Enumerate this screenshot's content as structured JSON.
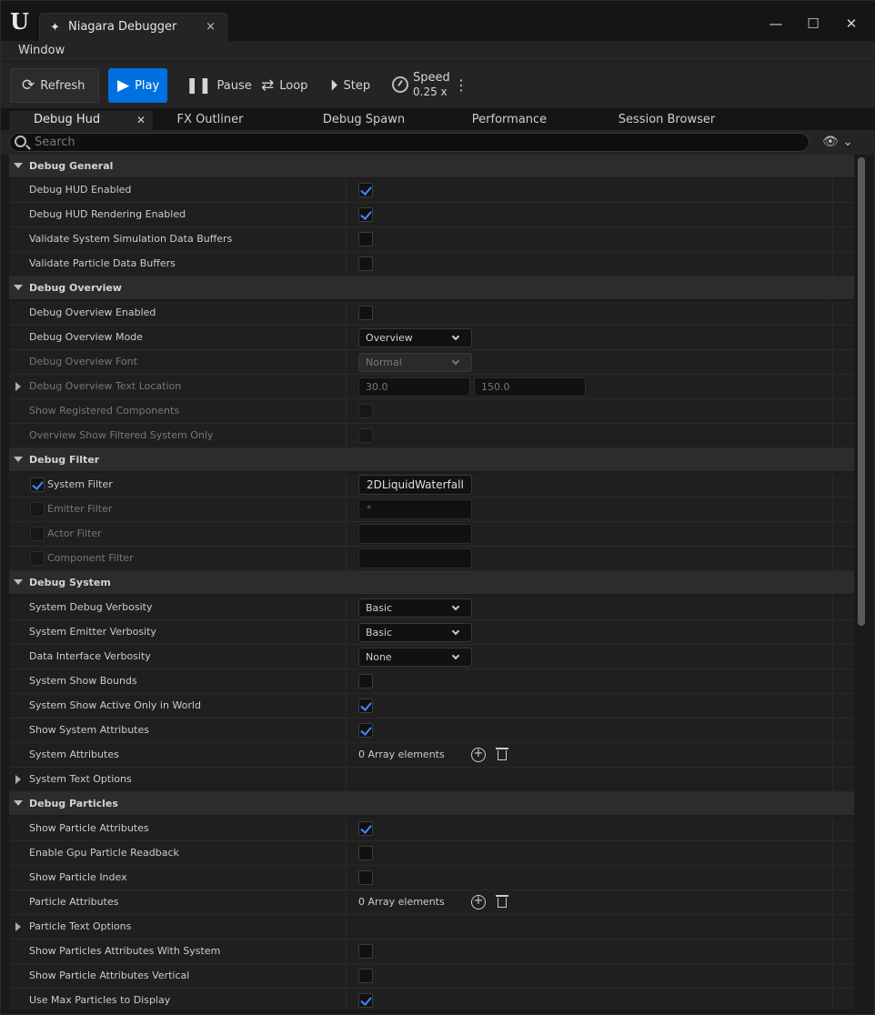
{
  "window": {
    "tab_title": "Niagara Debugger",
    "tab_close": "×",
    "minimize": "—",
    "maximize": "☐",
    "close": "✕"
  },
  "menu": {
    "window": "Window"
  },
  "toolbar": {
    "refresh": "Refresh",
    "play": "Play",
    "pause": "Pause",
    "loop": "Loop",
    "step": "Step",
    "speed_label": "Speed",
    "speed_value": "0.25 x"
  },
  "tabs": [
    {
      "label": "Debug Hud",
      "active": true
    },
    {
      "label": "FX Outliner"
    },
    {
      "label": "Debug Spawn"
    },
    {
      "label": "Performance"
    },
    {
      "label": "Session Browser"
    }
  ],
  "search": {
    "placeholder": "Search"
  },
  "categories": {
    "general": "Debug General",
    "overview": "Debug Overview",
    "filter": "Debug Filter",
    "system": "Debug System",
    "particles": "Debug Particles"
  },
  "general": {
    "hud_enabled": "Debug HUD Enabled",
    "hud_rendering": "Debug HUD Rendering Enabled",
    "validate_system": "Validate System Simulation Data Buffers",
    "validate_particle": "Validate Particle Data Buffers"
  },
  "overview": {
    "enabled": "Debug Overview Enabled",
    "mode": "Debug Overview Mode",
    "mode_value": "Overview",
    "font": "Debug Overview Font",
    "font_value": "Normal",
    "text_location": "Debug Overview Text Location",
    "loc_x": "30.0",
    "loc_y": "150.0",
    "show_registered": "Show Registered Components",
    "filtered_only": "Overview Show Filtered System Only"
  },
  "filter": {
    "system": "System Filter",
    "system_value": "2DLiquidWaterfall",
    "emitter": "Emitter Filter",
    "emitter_value": "*",
    "actor": "Actor Filter",
    "component": "Component Filter"
  },
  "system": {
    "debug_verbosity": "System Debug Verbosity",
    "debug_verbosity_value": "Basic",
    "emitter_verbosity": "System Emitter Verbosity",
    "emitter_verbosity_value": "Basic",
    "di_verbosity": "Data Interface Verbosity",
    "di_verbosity_value": "None",
    "show_bounds": "System Show Bounds",
    "active_only": "System Show Active Only in World",
    "show_attributes": "Show System Attributes",
    "attributes": "System Attributes",
    "attributes_value": "0 Array elements",
    "text_options": "System Text Options"
  },
  "particles": {
    "show_attributes": "Show Particle Attributes",
    "gpu_readback": "Enable Gpu Particle Readback",
    "show_index": "Show Particle Index",
    "attributes": "Particle Attributes",
    "attributes_value": "0 Array elements",
    "text_options": "Particle Text Options",
    "with_system": "Show Particles Attributes With System",
    "vertical": "Show Particle Attributes Vertical",
    "max_particles": "Use Max Particles to Display"
  },
  "colors": {
    "accent": "#0070e0",
    "check": "#3d8bff",
    "background": "#1a1a1a"
  }
}
